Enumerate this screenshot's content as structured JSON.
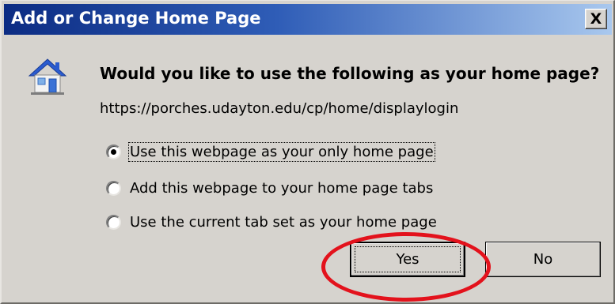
{
  "dialog": {
    "title": "Add or Change Home Page",
    "close_label": "X",
    "question": "Would you like to use the following as your home page?",
    "url": "https://porches.udayton.edu/cp/home/displaylogin"
  },
  "options": [
    {
      "label": "Use this webpage as your only home page",
      "checked": true
    },
    {
      "label": "Add this webpage to your home page tabs",
      "checked": false
    },
    {
      "label": "Use the current tab set as your home page",
      "checked": false
    }
  ],
  "buttons": {
    "yes_label": "Yes",
    "no_label": "No"
  },
  "icons": {
    "dialog_icon": "home-icon"
  },
  "colors": {
    "titlebar_start": "#0c2c83",
    "titlebar_end": "#a9c8ee",
    "dialog_bg": "#d6d3ce",
    "annotation": "#e3121c"
  }
}
